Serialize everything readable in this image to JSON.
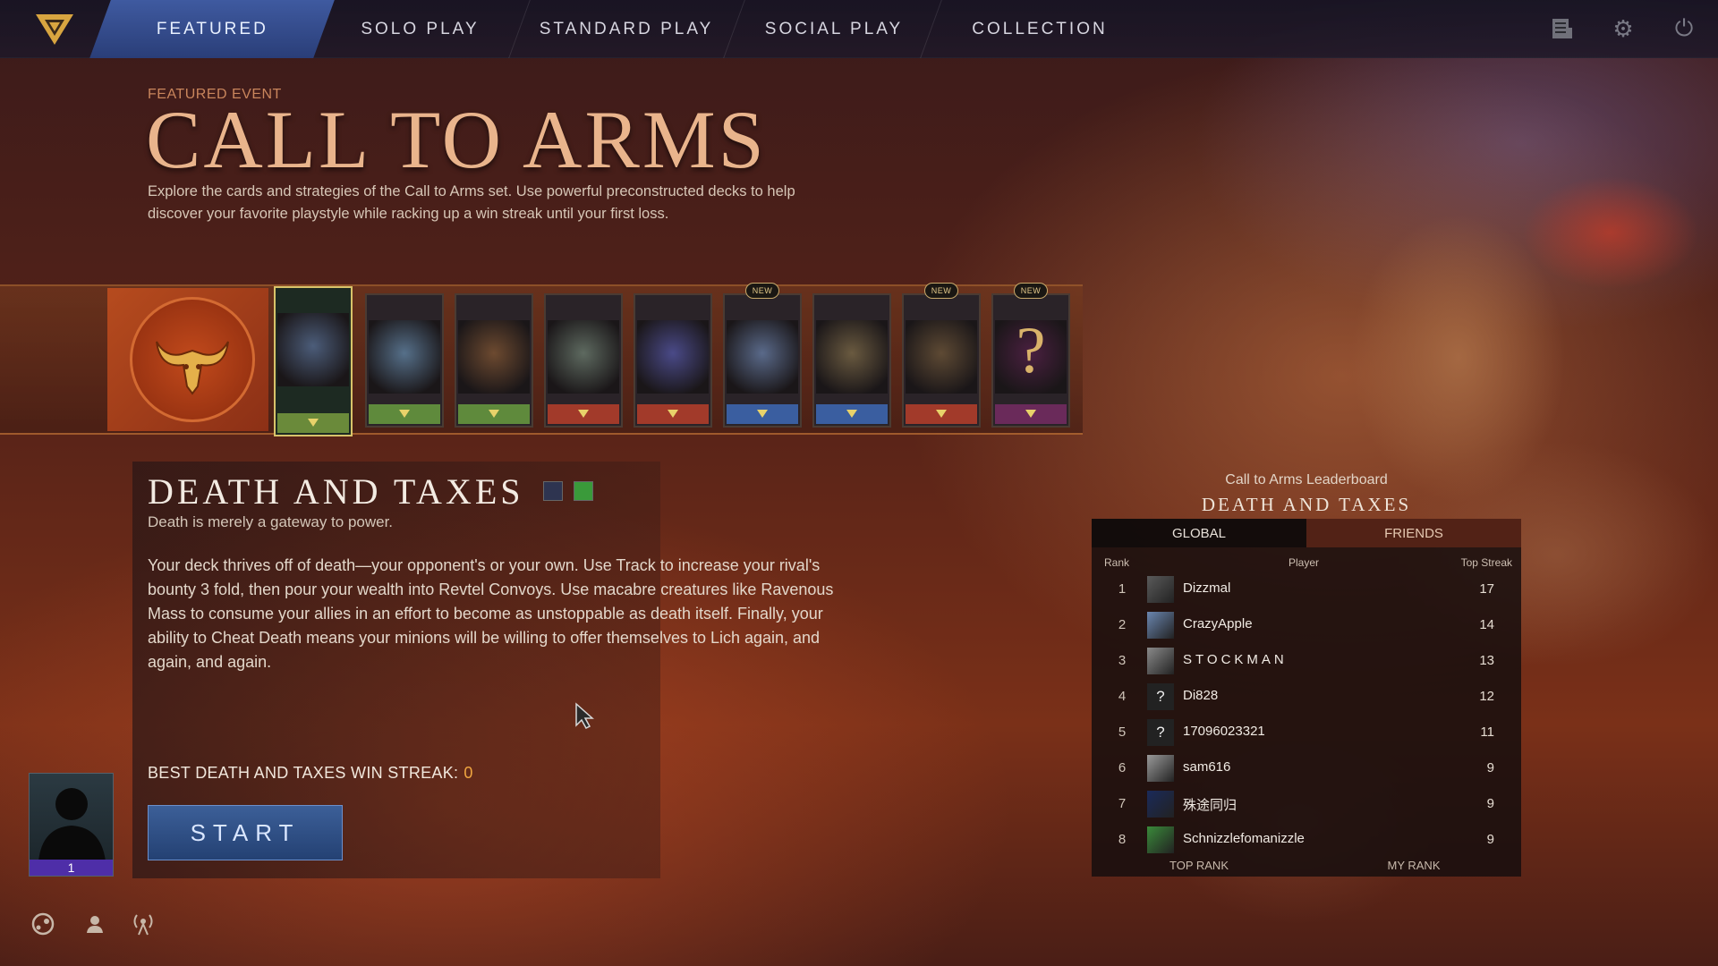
{
  "nav": {
    "tabs": [
      {
        "label": "FEATURED",
        "active": true
      },
      {
        "label": "SOLO PLAY"
      },
      {
        "label": "STANDARD PLAY"
      },
      {
        "label": "SOCIAL PLAY"
      },
      {
        "label": "COLLECTION"
      }
    ],
    "icons": [
      "news-icon",
      "gear-icon",
      "power-icon"
    ]
  },
  "event": {
    "label": "FEATURED EVENT",
    "title": "CALL TO ARMS",
    "description": "Explore the cards and strategies of the Call to Arms set. Use powerful preconstructed decks to help discover your favorite playstyle while racking up a win streak until your first loss."
  },
  "deck_strip": {
    "emblem_icon": "bull-skull-icon",
    "new_label": "NEW",
    "cards": [
      {
        "name": "deck-1",
        "selected": true,
        "band": "#6a8a3a",
        "art": "#4c5d7a",
        "new": false
      },
      {
        "name": "deck-2",
        "band": "#5f8a3c",
        "art": "#56708a",
        "new": false
      },
      {
        "name": "deck-3",
        "band": "#5f8a3c",
        "art": "#6d4a30",
        "new": false
      },
      {
        "name": "deck-4",
        "band": "#a23a2a",
        "art": "#5e6a60",
        "new": false
      },
      {
        "name": "deck-5",
        "band": "#a23a2a",
        "art": "#4a4a88",
        "new": false
      },
      {
        "name": "deck-6",
        "band": "#3a5ea0",
        "art": "#5a6a8a",
        "new": true
      },
      {
        "name": "deck-7",
        "band": "#3a5ea0",
        "art": "#6a5a40",
        "new": false
      },
      {
        "name": "deck-8",
        "band": "#a23a2a",
        "art": "#5e4a34",
        "new": true
      },
      {
        "name": "deck-9",
        "band": "#6a2a5a",
        "art": "#4a2040",
        "new": true,
        "mystery": "?"
      }
    ]
  },
  "deck": {
    "title": "DEATH AND TAXES",
    "colors": [
      "#2e3450",
      "#3a9a3a"
    ],
    "tagline": "Death is merely a gateway to power.",
    "description": "Your deck thrives off of death—your opponent's or your own. Use Track to increase your rival's bounty 3 fold, then pour your wealth into Revtel Convoys. Use macabre creatures like Ravenous Mass to consume your allies in an effort to become as unstoppable as death itself. Finally, your ability to Cheat Death means your minions will be willing to offer themselves to Lich again, and again, and again.",
    "streak_label": "BEST DEATH AND TAXES WIN STREAK:",
    "streak_value": "0",
    "start_label": "START"
  },
  "leaderboard": {
    "caption": "Call to Arms Leaderboard",
    "subtitle": "DEATH AND TAXES",
    "tabs": {
      "global": "GLOBAL",
      "friends": "FRIENDS"
    },
    "headers": {
      "rank": "Rank",
      "player": "Player",
      "streak": "Top Streak"
    },
    "rows": [
      {
        "rank": "1",
        "player": "Dizzmal",
        "streak": "17",
        "avatar": "#5a5a5a"
      },
      {
        "rank": "2",
        "player": "CrazyApple",
        "streak": "14",
        "avatar": "#6a86b0"
      },
      {
        "rank": "3",
        "player": "STOCKMAN",
        "streak": "13",
        "avatar": "#8a8a8a"
      },
      {
        "rank": "4",
        "player": "Di828",
        "streak": "12",
        "avatar": "?"
      },
      {
        "rank": "5",
        "player": "17096023321",
        "streak": "11",
        "avatar": "?"
      },
      {
        "rank": "6",
        "player": "sam616",
        "streak": "9",
        "avatar": "#9a9a9a"
      },
      {
        "rank": "7",
        "player": "殊途同归",
        "streak": "9",
        "avatar": "#1a2a5a"
      },
      {
        "rank": "8",
        "player": "Schnizzlefomanizzle",
        "streak": "9",
        "avatar": "#3a8a3a"
      }
    ],
    "footer": {
      "top": "TOP RANK",
      "mine": "MY RANK"
    }
  },
  "profile": {
    "level": "1"
  },
  "bottom_icons": [
    "steam-icon",
    "friend-icon",
    "broadcast-icon"
  ]
}
